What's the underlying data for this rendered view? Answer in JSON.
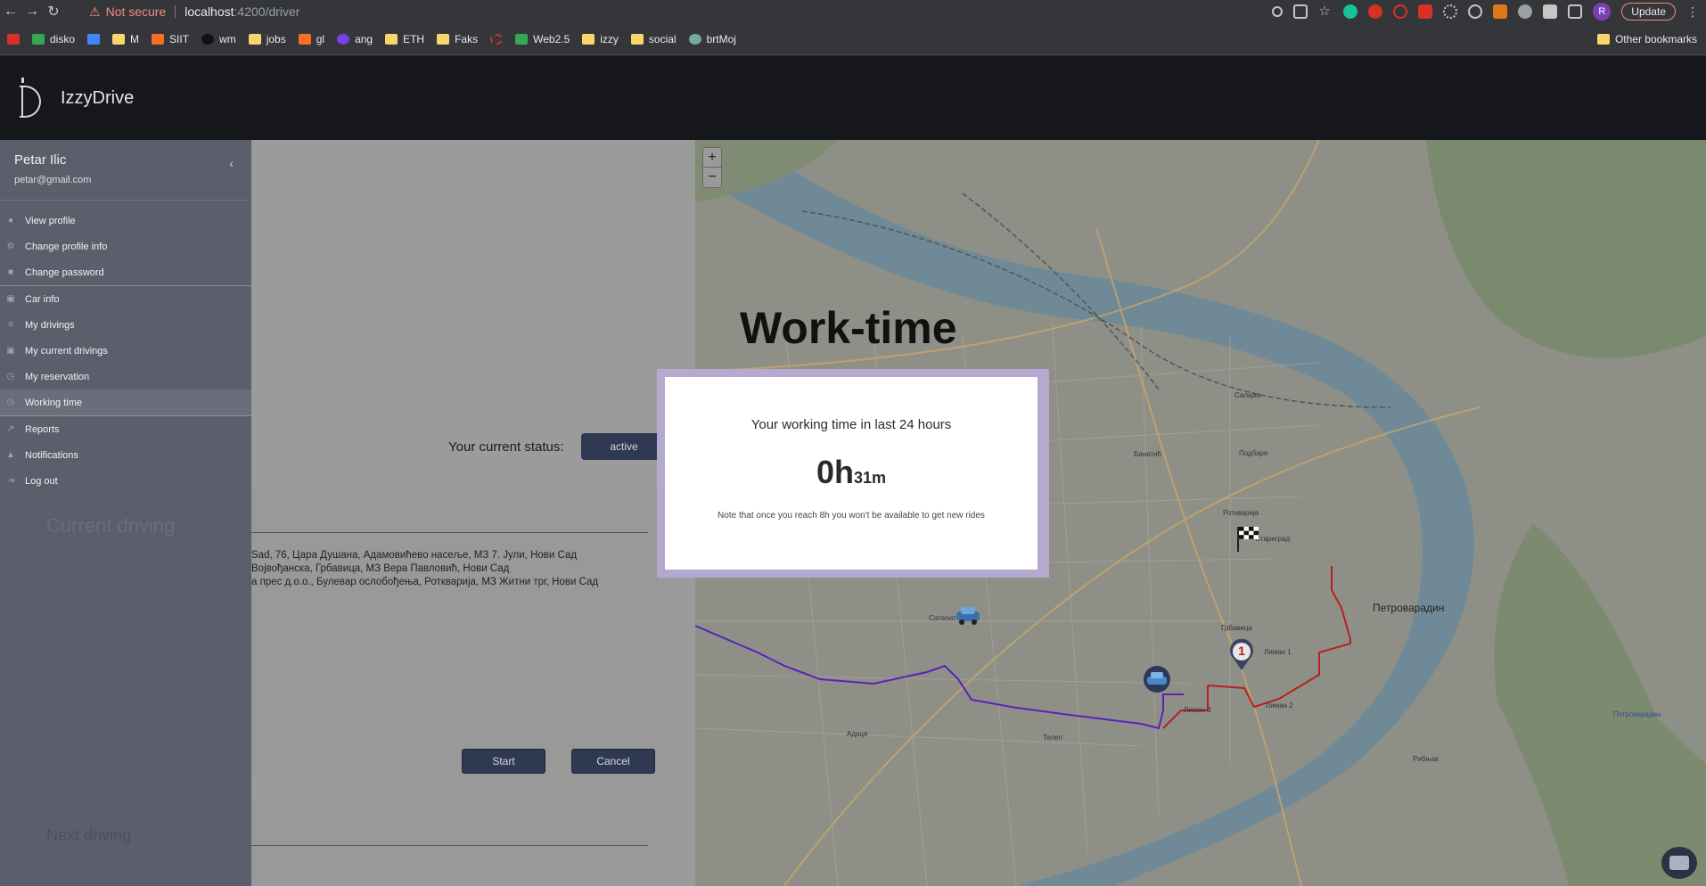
{
  "browser": {
    "security_text": "Not secure",
    "url_host": "localhost",
    "url_path": ":4200/driver",
    "update_label": "Update",
    "profile_initial": "R",
    "bookmarks": [
      "disko",
      "M",
      "SIIT",
      "wm",
      "jobs",
      "gl",
      "ang",
      "ETH",
      "Faks",
      "Web2.5",
      "izzy",
      "social",
      "brtMoj"
    ],
    "other_bookmarks": "Other bookmarks"
  },
  "app": {
    "brand": "IzzyDrive"
  },
  "sidebar": {
    "user_name": "Petar Ilic",
    "user_email": "petar@gmail.com",
    "items": [
      {
        "label": "View profile",
        "icon": "person-icon"
      },
      {
        "label": "Change profile info",
        "icon": "gear-icon"
      },
      {
        "label": "Change password",
        "icon": "lock-icon"
      },
      {
        "label": "Car info",
        "icon": "car-icon"
      },
      {
        "label": "My drivings",
        "icon": "list-icon"
      },
      {
        "label": "My current drivings",
        "icon": "car-icon"
      },
      {
        "label": "My reservation",
        "icon": "clock-icon"
      },
      {
        "label": "Working time",
        "icon": "clock-icon"
      },
      {
        "label": "Reports",
        "icon": "chart-icon"
      },
      {
        "label": "Notifications",
        "icon": "bell-icon"
      },
      {
        "label": "Log out",
        "icon": "logout-icon"
      }
    ],
    "ghost_current": "Current driving",
    "ghost_next": "Next driving"
  },
  "main": {
    "status_label": "Your current status:",
    "status_value": "active",
    "addresses": [
      "Sad, 76, Цара Душана, Адамовићево насеље, МЗ 7. Јули, Нови Сад",
      "Војвођанска, Грбавица, МЗ Вера Павловић, Нови Сад",
      "а прес д.о.о., Булевар ослобођења, Ротквариjа, МЗ Житни трг, Нови Сад"
    ],
    "start_label": "Start",
    "cancel_label": "Cancel"
  },
  "page": {
    "worktime_title": "Work-time"
  },
  "modal": {
    "heading": "Your working time in last 24 hours",
    "hours": "0h",
    "minutes": "31m",
    "note": "Note that once you reach 8h you won't be available to get new rides"
  },
  "map": {
    "zoom_in": "+",
    "zoom_out": "−",
    "labels": [
      "Петроварадин",
      "Сателит",
      "Адице",
      "Лиман 1",
      "Лиман 2",
      "Лиман 3",
      "Ротквариjа",
      "Стариград",
      "Грбавица",
      "Банатић",
      "Салајка",
      "Подбаре",
      "Телеп",
      "Рибњак",
      "Петроварадин"
    ],
    "marker_number": "1"
  }
}
